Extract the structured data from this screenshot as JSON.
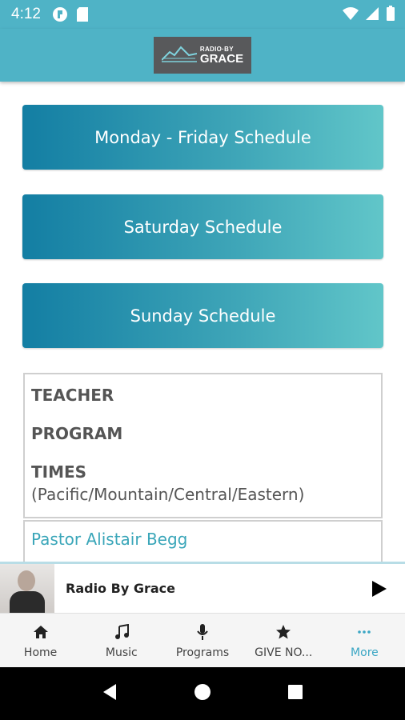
{
  "status_bar": {
    "time": "4:12"
  },
  "app_bar": {
    "logo_line1": "RADIO·BY",
    "logo_line2": "GRACE"
  },
  "schedules": [
    {
      "label": "Monday - Friday Schedule"
    },
    {
      "label": "Saturday Schedule"
    },
    {
      "label": "Sunday Schedule"
    }
  ],
  "info": {
    "teacher_header": "TEACHER",
    "program_header": "PROGRAM",
    "times_header": "TIMES",
    "timezones": "(Pacific/Mountain/Central/Eastern)"
  },
  "entries": [
    {
      "teacher": "Pastor Alistair Begg"
    }
  ],
  "player": {
    "title": "Radio By Grace"
  },
  "bottom_nav": [
    {
      "label": "Home",
      "icon": "home-icon"
    },
    {
      "label": "Music",
      "icon": "music-icon"
    },
    {
      "label": "Programs",
      "icon": "microphone-icon"
    },
    {
      "label": "GIVE NO...",
      "icon": "star-icon"
    },
    {
      "label": "More",
      "icon": "more-icon"
    }
  ],
  "colors": {
    "header": "#4fb3c6",
    "accent": "#3aa6c4",
    "button_start": "#137ea3",
    "button_end": "#61c6c9"
  }
}
